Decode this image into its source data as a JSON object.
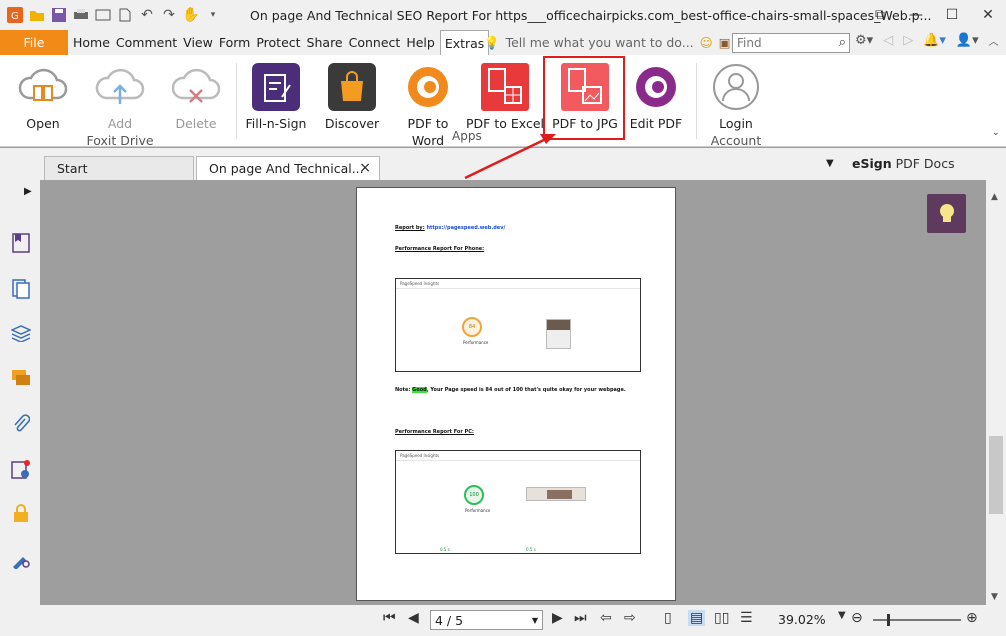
{
  "window": {
    "title": "On page And Technical SEO Report For https___officechairpicks.com_best-office-chairs-small-spaces_Web.p..."
  },
  "menu": {
    "file": "File",
    "items": [
      "Home",
      "Comment",
      "View",
      "Form",
      "Protect",
      "Share",
      "Connect",
      "Help"
    ],
    "active": "Extras",
    "tell_me": "Tell me what you want to do...",
    "find_placeholder": "Find"
  },
  "ribbon": {
    "buttons": {
      "open": "Open",
      "add1": "Add",
      "add2": "Foxit Drive",
      "delete": "Delete",
      "fillsign": "Fill-n-Sign",
      "discover": "Discover",
      "pdf2word": "PDF to Word",
      "pdf2excel": "PDF to Excel",
      "pdf2jpg": "PDF to JPG",
      "editpdf": "Edit PDF",
      "login1": "Login",
      "login2": "Account"
    },
    "group_apps": "Apps"
  },
  "tabs": {
    "start": "Start",
    "doc": "On page And Technical...",
    "close": "×"
  },
  "esign": {
    "bold": "eSign",
    "rest": " PDF Docs"
  },
  "page_content": {
    "report_by_label": "Report by:",
    "report_by_url": " https://pagespeed.web.dev/",
    "phone_heading": "Performance Report For Phone:",
    "psi_title": "PageSpeed Insights",
    "phone_score": "84",
    "perf_label": "Performance",
    "note_prefix": "Note: ",
    "note_highlight": "Good",
    "note_rest": ", Your Page speed is 84 out of 100 that's quite okay for your webpage.",
    "pc_heading": "Performance Report For PC:",
    "pc_score": "100",
    "pc_metric1": "0.5 s",
    "pc_metric2": "0.5 s"
  },
  "status": {
    "page": "4 / 5",
    "zoom": "39.02%"
  },
  "colors": {
    "file_orange": "#f28a18",
    "highlight_red": "#e21b1b",
    "bulb_purple": "#5e3b5e"
  }
}
